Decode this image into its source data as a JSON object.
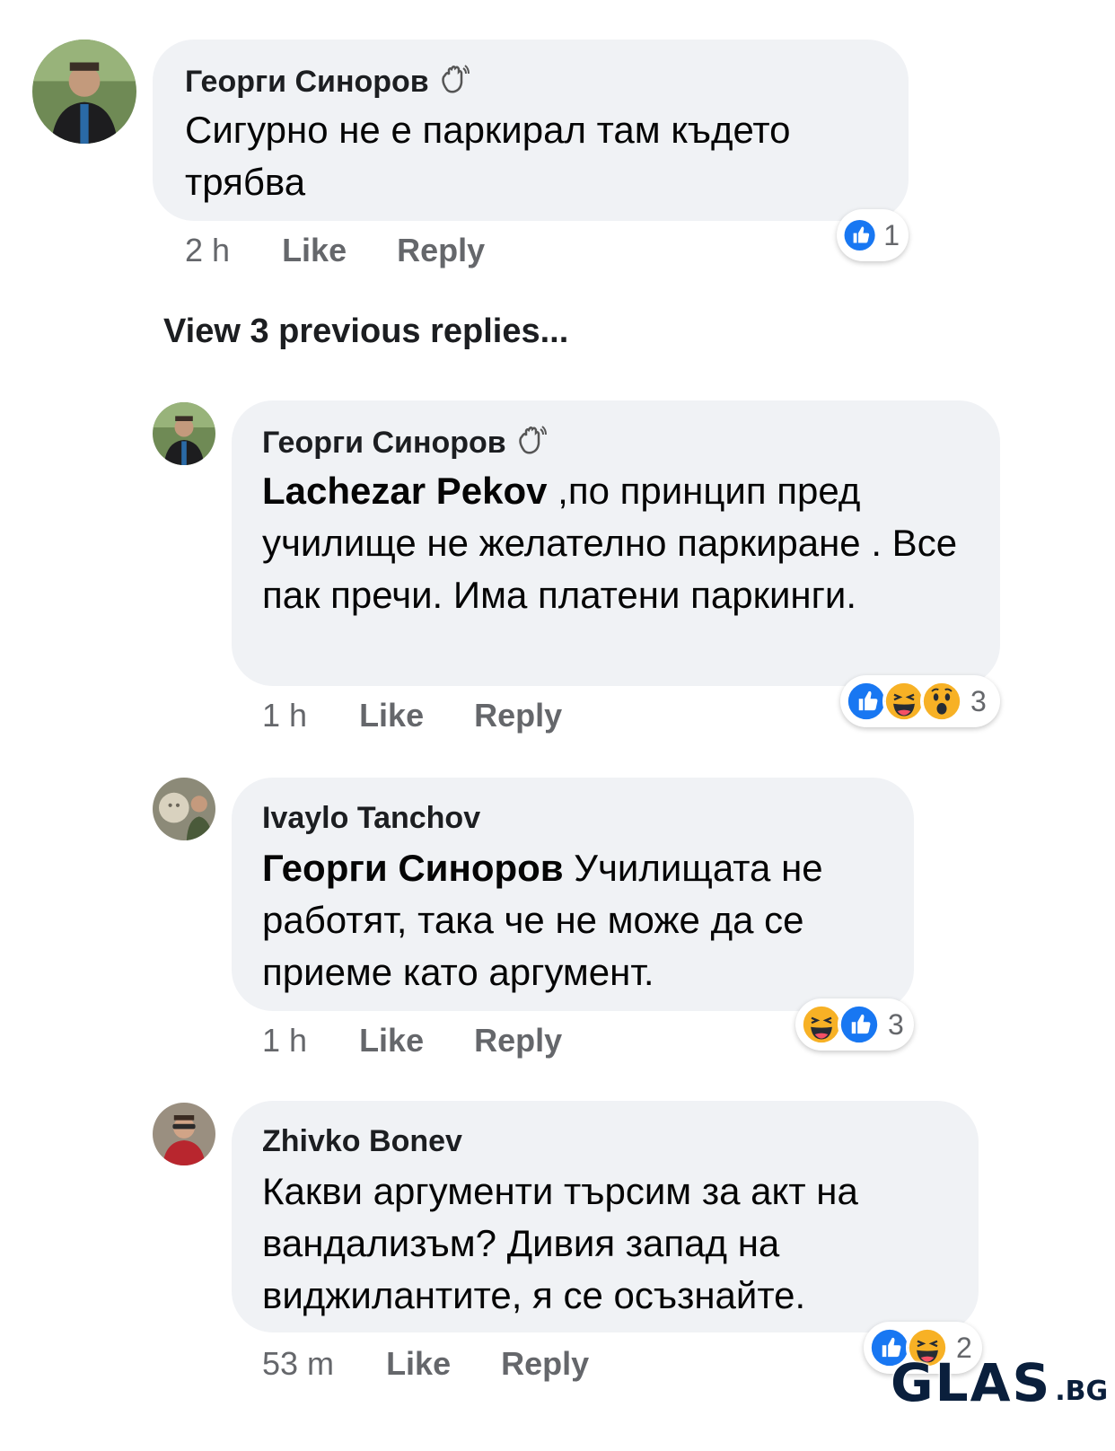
{
  "comments": [
    {
      "author": "Георги Синоров",
      "text": "Сигурно не е паркирал там където трябва",
      "time": "2 h",
      "like_label": "Like",
      "reply_label": "Reply",
      "reaction_icons": [
        "like-icon"
      ],
      "reaction_count": "1"
    },
    {
      "author": "Георги Синоров",
      "mention": "Lachezar Pekov",
      "text": " ,по принцип пред училище не желателно паркиране . Все пак пречи. Има платени паркинги.",
      "time": "1 h",
      "like_label": "Like",
      "reply_label": "Reply",
      "reaction_icons": [
        "like-icon",
        "haha-icon",
        "wow-icon"
      ],
      "reaction_count": "3"
    },
    {
      "author": "Ivaylo Tanchov",
      "mention": "Георги Синоров",
      "text": " Училищата не работят, така че не може да се приеме като аргумент.",
      "time": "1 h",
      "like_label": "Like",
      "reply_label": "Reply",
      "reaction_icons": [
        "haha-icon",
        "like-icon"
      ],
      "reaction_count": "3"
    },
    {
      "author": "Zhivko Bonev",
      "text": "Какви аргументи търсим за акт на вандализъм? Дивия запад на виджилантите, я се осъзнайте.",
      "time": "53 m",
      "like_label": "Like",
      "reply_label": "Reply",
      "reaction_icons": [
        "like-icon",
        "haha-icon"
      ],
      "reaction_count": "2"
    }
  ],
  "view_previous": "View 3 previous replies...",
  "watermark": {
    "main": "GLAS",
    "tld": ".BG"
  },
  "colors": {
    "bubble": "#f0f2f5",
    "meta_text": "#65676b",
    "like_blue": "#1877f2",
    "emoji_yellow": "#f7b125"
  }
}
